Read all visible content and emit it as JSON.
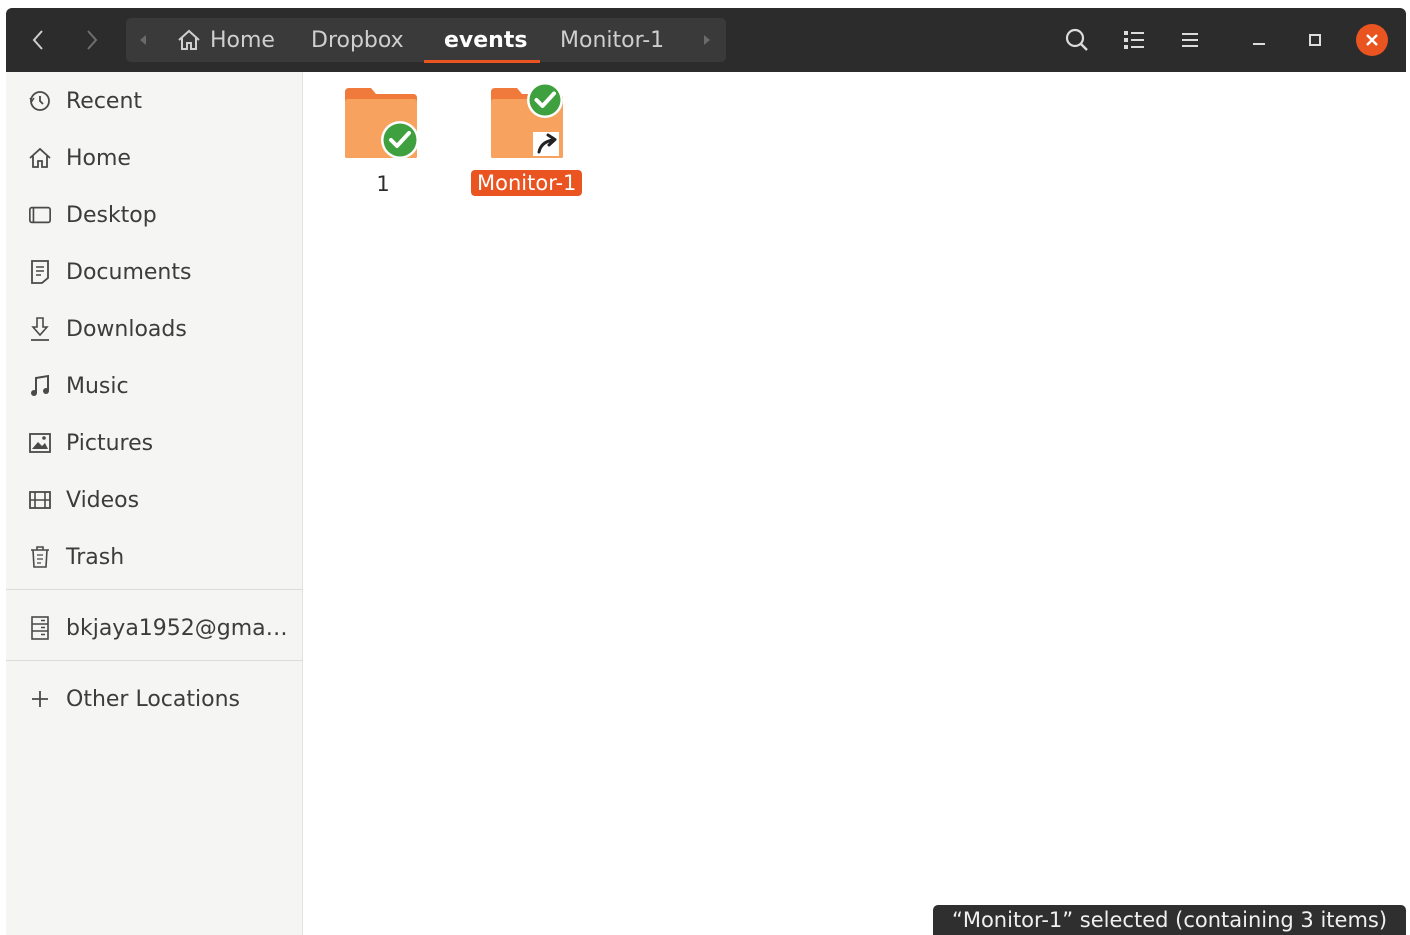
{
  "headerbar": {
    "nav_back_icon": "chevron-left-icon",
    "nav_forward_icon": "chevron-right-icon",
    "path": [
      {
        "label": "Home",
        "icon": "home-icon"
      },
      {
        "label": "Dropbox"
      },
      {
        "label": "events",
        "active": true
      },
      {
        "label": "Monitor-1"
      }
    ],
    "actions": [
      "search-icon",
      "list-view-icon",
      "menu-icon"
    ],
    "window_controls": [
      "minimize-icon",
      "maximize-icon",
      "close-icon"
    ],
    "close_color": "#e95420"
  },
  "sidebar": {
    "places": [
      {
        "label": "Recent",
        "icon": "clock-icon"
      },
      {
        "label": "Home",
        "icon": "home-icon"
      },
      {
        "label": "Desktop",
        "icon": "desktop-icon"
      },
      {
        "label": "Documents",
        "icon": "document-icon"
      },
      {
        "label": "Downloads",
        "icon": "download-icon"
      },
      {
        "label": "Music",
        "icon": "music-note-icon"
      },
      {
        "label": "Pictures",
        "icon": "picture-icon"
      },
      {
        "label": "Videos",
        "icon": "film-icon"
      },
      {
        "label": "Trash",
        "icon": "trash-icon"
      }
    ],
    "account": {
      "label": "bkjaya1952@gma…",
      "icon": "server-icon"
    },
    "other": {
      "label": "Other Locations",
      "icon": "plus-icon"
    }
  },
  "files": [
    {
      "name": "1",
      "type": "folder",
      "synced": true,
      "selected": false
    },
    {
      "name": "Monitor-1",
      "type": "folder-link",
      "synced": true,
      "selected": true
    }
  ],
  "status": {
    "text": "“Monitor-1” selected  (containing 3 items)"
  },
  "colors": {
    "accent": "#e95420",
    "folder": "#f08a4b",
    "sync_ok": "#3ea03e",
    "headerbar": "#2c2c2c"
  }
}
